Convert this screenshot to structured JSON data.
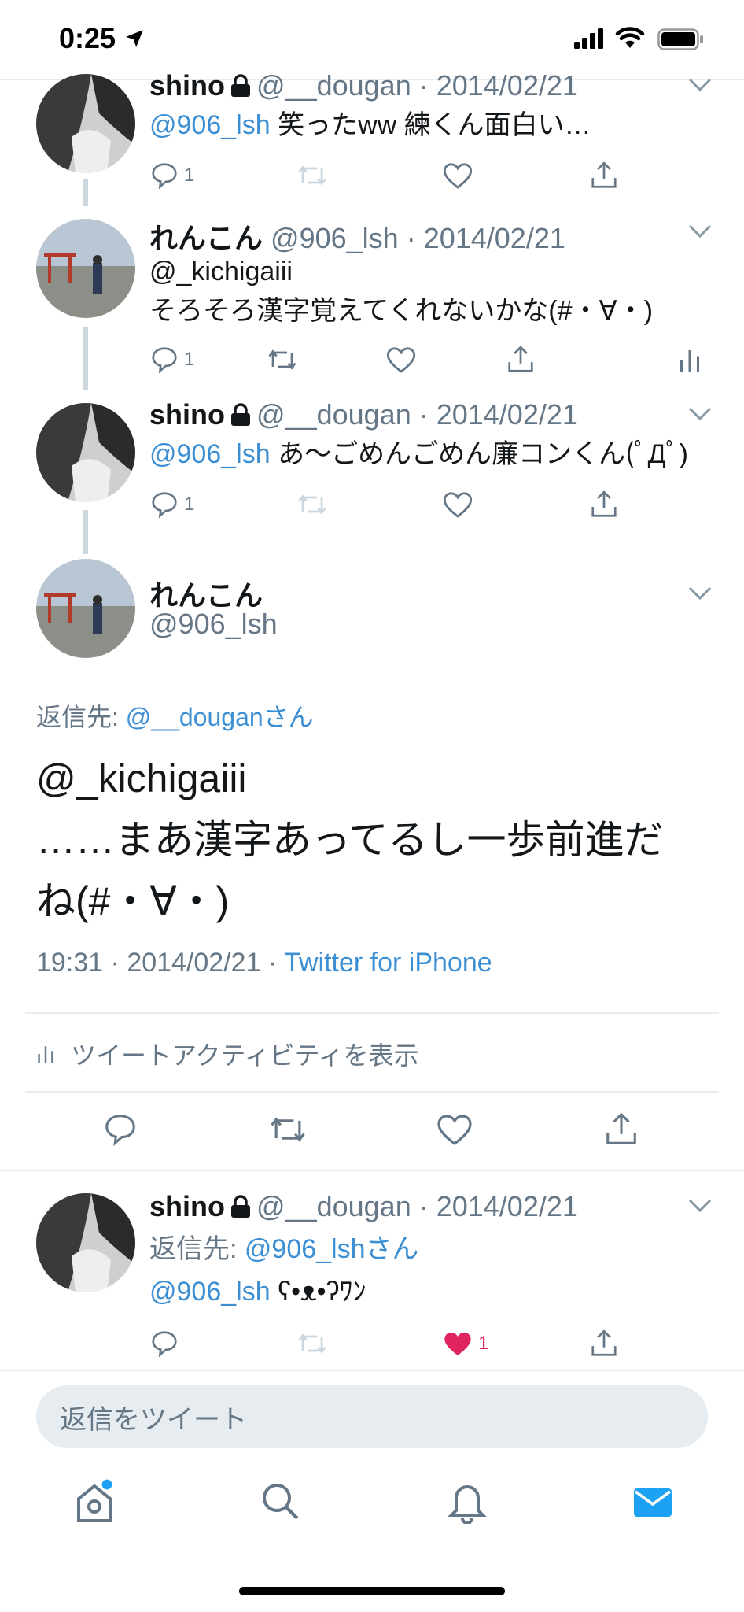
{
  "status_bar": {
    "time": "0:25"
  },
  "tweets": [
    {
      "name": "shino",
      "locked": true,
      "handle": "@__dougan",
      "date": "2014/02/21",
      "mention": "@906_lsh",
      "text": "笑ったww 練くん面白い…",
      "reply_count": "1"
    },
    {
      "name": "れんこん",
      "handle": "@906_lsh",
      "date": "2014/02/21",
      "line1": "@_kichigaiii",
      "line2": "そろそろ漢字覚えてくれないかな(#・∀・)",
      "reply_count": "1"
    },
    {
      "name": "shino",
      "locked": true,
      "handle": "@__dougan",
      "date": "2014/02/21",
      "mention": "@906_lsh",
      "text": "あ〜ごめんごめん廉コンくん(ﾟДﾟ)",
      "reply_count": "1"
    }
  ],
  "main_tweet": {
    "name": "れんこん",
    "handle": "@906_lsh",
    "replying_label": "返信先: ",
    "replying_to": "@__douganさん",
    "text": "@_kichigaiii\n……まあ漢字あってるし一歩前進だ\nね(#・∀・)",
    "time": "19:31",
    "date": "2014/02/21",
    "source": "Twitter for iPhone",
    "activity_label": "ツイートアクティビティを表示"
  },
  "reply_tweet": {
    "name": "shino",
    "locked": true,
    "handle": "@__dougan",
    "date": "2014/02/21",
    "replying_label": "返信先: ",
    "replying_to": "@906_lshさん",
    "mention": "@906_lsh",
    "text": "ʕ•ᴥ•ʔﾜﾝ",
    "like_count": "1"
  },
  "reply_box": {
    "placeholder": "返信をツイート"
  },
  "tab_bar": {
    "items": [
      "home-icon",
      "search-icon",
      "notifications-icon",
      "messages-icon"
    ]
  },
  "colors": {
    "accent": "#1da1f2",
    "mention": "#3d8fd4",
    "like": "#e0245e",
    "muted": "#657786"
  }
}
